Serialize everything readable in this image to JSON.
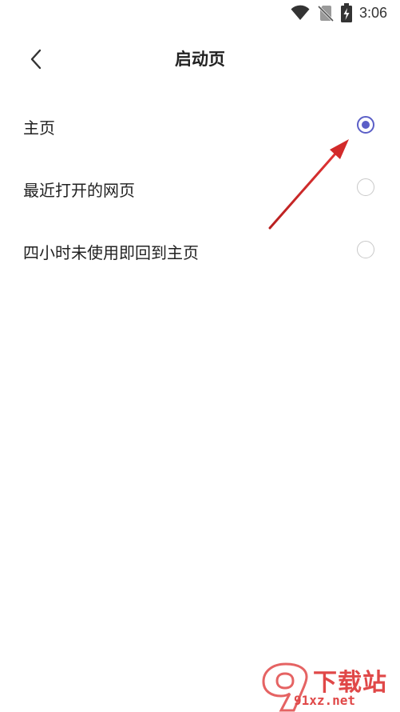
{
  "status_bar": {
    "time": "3:06",
    "icons": [
      "wifi-icon",
      "no-sim-icon",
      "battery-charging-icon"
    ]
  },
  "header": {
    "title": "启动页",
    "back_icon": "chevron-left-icon"
  },
  "options": [
    {
      "label": "主页",
      "selected": true
    },
    {
      "label": "最近打开的网页",
      "selected": false
    },
    {
      "label": "四小时未使用即回到主页",
      "selected": false
    }
  ],
  "colors": {
    "accent": "#5b5fc7",
    "radio_border": "#c8c8c8",
    "annotation": "#d22a2a",
    "watermark": "#e04848"
  },
  "watermark": {
    "logo_glyph": "9",
    "site_text": "下载站",
    "domain": "91xz.net"
  }
}
